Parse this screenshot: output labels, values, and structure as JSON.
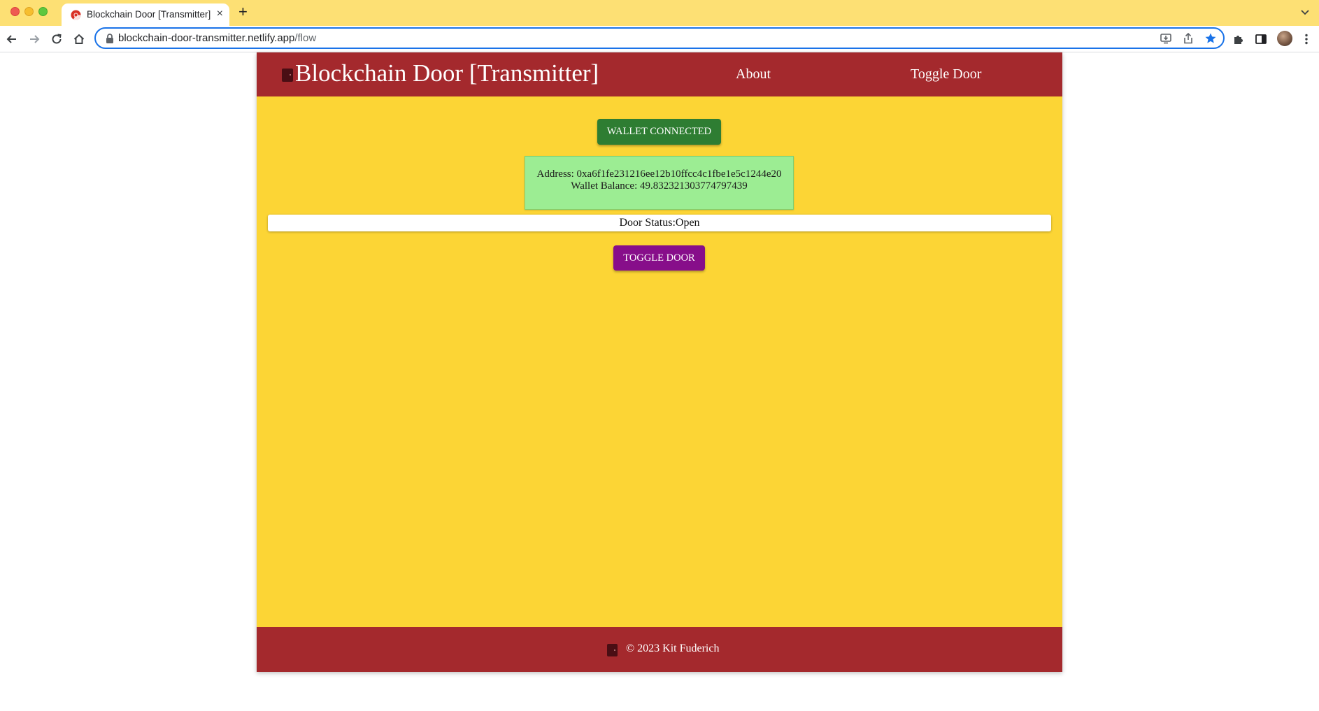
{
  "browser": {
    "tab": {
      "title": "Blockchain Door [Transmitter]",
      "favicon": "chrome-logo-icon",
      "close": "×"
    },
    "new_tab": "+",
    "address_bar": {
      "host": "blockchain-door-transmitter.netlify.app",
      "path": "/flow",
      "bookmarked": true
    },
    "colors": {
      "tab_strip": "#fde074",
      "omnibox_focus": "#1a73e8"
    }
  },
  "header": {
    "title": "Blockchain Door [Transmitter]",
    "nav": {
      "about": "About",
      "toggle_door": "Toggle Door"
    },
    "icon": "door-icon"
  },
  "main": {
    "wallet_button": "WALLET CONNECTED",
    "wallet": {
      "address_line": "Address: 0xa6f1fe231216ee12b10ffcc4c1fbe1e5c1244e20",
      "balance_line": "Wallet Balance: 49.832321303774797439"
    },
    "door_status": "Door Status:Open",
    "toggle_button": "TOGGLE DOOR"
  },
  "footer": {
    "text": "© 2023 Kit Fuderich",
    "icon": "door-icon"
  },
  "colors": {
    "header_bg": "#a4292d",
    "page_bg": "#fcd535",
    "wallet_button": "#2e7d32",
    "info_box": "#9ced93",
    "toggle_button": "#870e8a"
  }
}
